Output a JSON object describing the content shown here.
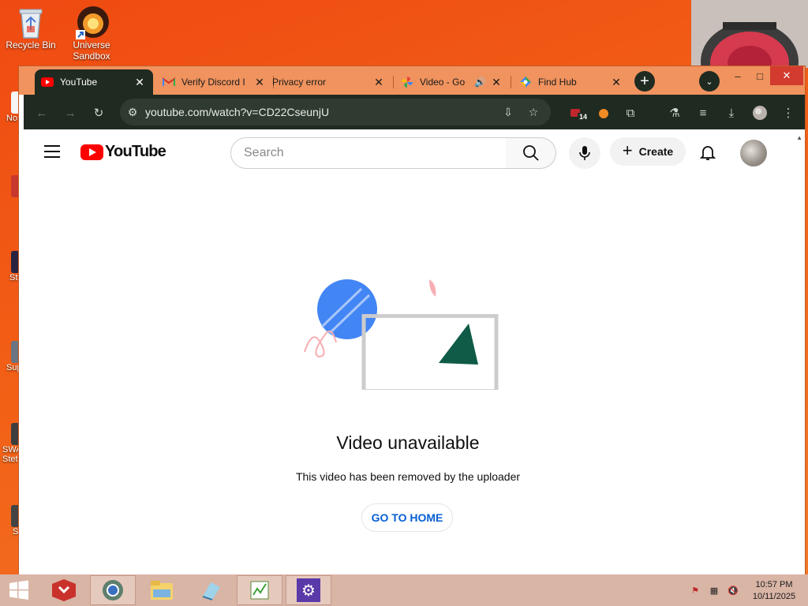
{
  "desktop": {
    "icons": [
      {
        "label": "Recycle Bin",
        "icon": "recycle-bin-icon"
      },
      {
        "label": "Universe Sandbox",
        "icon": "universe-sandbox-icon"
      }
    ],
    "left_strip_labels": [
      "No",
      "St",
      "Sup",
      "SWA Stet",
      "S"
    ]
  },
  "browser": {
    "tabs": [
      {
        "title": "YouTube",
        "icon": "youtube-favicon",
        "active": true
      },
      {
        "title": "Verify Discord I",
        "icon": "gmail-favicon"
      },
      {
        "title": "Privacy error",
        "icon": "none"
      },
      {
        "title": "Video - Go",
        "icon": "google-photos-favicon",
        "audio": true
      },
      {
        "title": "Find Hub",
        "icon": "find-hub-favicon"
      }
    ],
    "new_tab_label": "+",
    "window_controls": {
      "minimize": "–",
      "maximize": "□",
      "close": "✕"
    },
    "toolbar": {
      "url": "youtube.com/watch?v=CD22CseunjU",
      "extension_badge": "14"
    }
  },
  "youtube": {
    "logo_text": "YouTube",
    "search_placeholder": "Search",
    "create_label": "Create",
    "error_title": "Video unavailable",
    "error_message": "This video has been removed by the uploader",
    "go_home_label": "GO TO HOME"
  },
  "taskbar": {
    "apps": [
      "flash-app-icon",
      "chrome-app-icon",
      "file-explorer-icon",
      "notepad-app-icon",
      "paint-app-icon",
      "settings-app-icon"
    ],
    "clock_time": "10:57 PM",
    "clock_date": "10/11/2025"
  },
  "colors": {
    "desktop_orange": "#f26016",
    "browser_frame": "#1f2a20",
    "tabstrip": "#f0935e",
    "youtube_red": "#ff0000",
    "link_blue": "#065fd4",
    "taskbar": "#d9b5a6"
  }
}
